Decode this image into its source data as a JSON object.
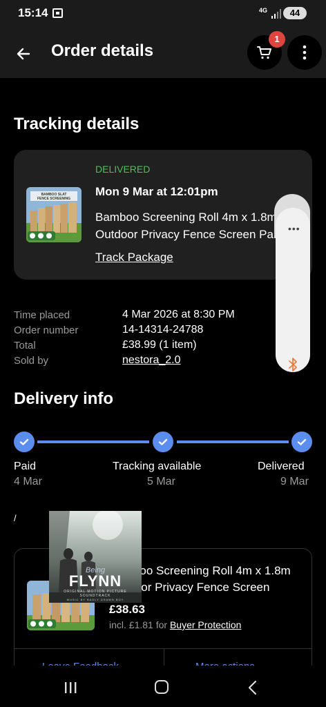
{
  "status_bar": {
    "time": "15:14",
    "network": "4G",
    "battery": "44"
  },
  "app_bar": {
    "title": "Order details",
    "cart_count": "1"
  },
  "tracking": {
    "heading": "Tracking details",
    "status": "DELIVERED",
    "delivered_date": "Mon 9 Mar at 12:01pm",
    "item_line1": "Bamboo Screening Roll 4m x 1.8m",
    "item_line2": "Outdoor Privacy Fence Screen Panel",
    "track_link": "Track Package",
    "thumb_line1": "BAMBOO SLAT",
    "thumb_line2": "FENCE SCREENING"
  },
  "order_info": {
    "rows": [
      {
        "label": "Time placed",
        "value": "4 Mar 2026 at 8:30 PM"
      },
      {
        "label": "Order number",
        "value": "14-14314-24788"
      },
      {
        "label": "Total",
        "value": "£38.99 (1 item)"
      },
      {
        "label": "Sold by",
        "value": "nestora_2.0"
      }
    ]
  },
  "delivery": {
    "heading": "Delivery info",
    "steps": [
      {
        "label": "Paid",
        "date": "4 Mar"
      },
      {
        "label": "Tracking available",
        "date": "5 Mar"
      },
      {
        "label": "Delivered",
        "date": "9 Mar"
      }
    ]
  },
  "item_card": {
    "title_line1": "Bamboo Screening Roll 4m x 1.8m",
    "title_line2": "Outdoor Privacy Fence Screen",
    "price": "£38.63",
    "fee_text": "incl. £1.81 for",
    "fee_link": "Buyer Protection",
    "btn_left": "Leave Feedback",
    "btn_right": "More actions"
  },
  "album_overlay": {
    "being": "Being",
    "title": "FLYNN",
    "subtitle": "ORIGINAL MOTION PICTURE SOUNDTRACK",
    "credit": "MUSIC BY BADLY DRAWN BOY"
  },
  "stray_text": "/",
  "colors": {
    "accent_blue": "#5b8dee",
    "delivered_green": "#4fbf5a",
    "badge_red": "#e0443f",
    "bluetooth_orange": "#f07a3a"
  }
}
